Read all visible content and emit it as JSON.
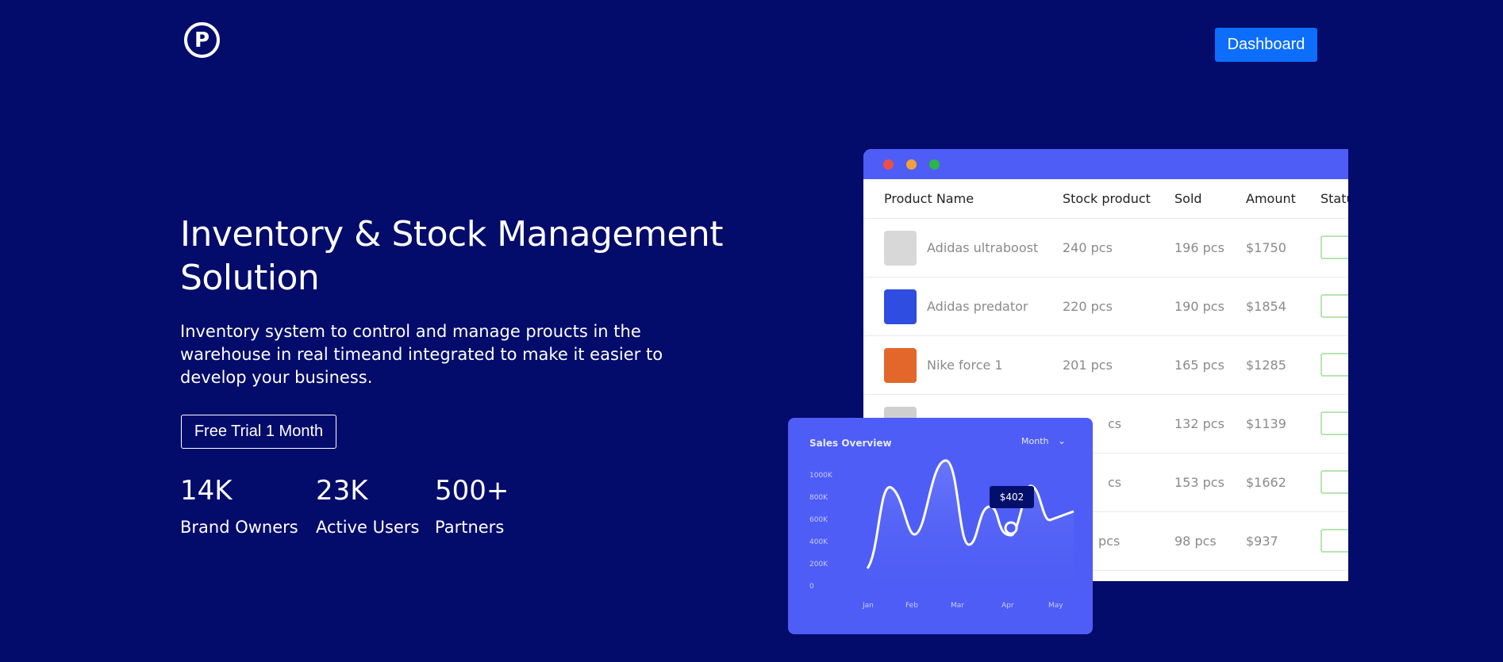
{
  "header": {
    "logo_letter": "P",
    "dashboard_label": "Dashboard"
  },
  "hero": {
    "title": "Inventory & Stock Management Solution",
    "subtitle": "Inventory system to control and manage proucts in the warehouse in real timeand integrated to make it easier to develop your business.",
    "cta_label": "Free Trial 1 Month",
    "stats": [
      {
        "value": "14K",
        "label": "Brand Owners"
      },
      {
        "value": "23K",
        "label": "Active Users"
      },
      {
        "value": "500+",
        "label": "Partners"
      }
    ]
  },
  "table": {
    "columns": [
      "Product Name",
      "Stock product",
      "Sold",
      "Amount",
      "Statu"
    ],
    "rows": [
      {
        "name": "Adidas ultraboost",
        "stock": "240 pcs",
        "sold": "196 pcs",
        "amount": "$1750"
      },
      {
        "name": "Adidas predator",
        "stock": "220 pcs",
        "sold": "190 pcs",
        "amount": "$1854"
      },
      {
        "name": "Nike force 1",
        "stock": "201 pcs",
        "sold": "165 pcs",
        "amount": "$1285"
      },
      {
        "name": "",
        "stock": "cs",
        "sold": "132 pcs",
        "amount": "$1139"
      },
      {
        "name": "",
        "stock": "cs",
        "sold": "153 pcs",
        "amount": "$1662"
      },
      {
        "name": "",
        "stock": "pcs",
        "sold": "98 pcs",
        "amount": "$937"
      }
    ],
    "window_dots": [
      "#e8504a",
      "#f2a13a",
      "#2bb54a"
    ],
    "thumb_colors": [
      "#d8d8d8",
      "#2f4de0",
      "#e3672a",
      "#cfcfcf"
    ]
  },
  "sales": {
    "title": "Sales Overview",
    "period": "Month",
    "tooltip": "$402",
    "y_ticks": [
      "1000K",
      "800K",
      "600K",
      "400K",
      "200K",
      "0"
    ],
    "x_ticks": [
      "Jan",
      "Feb",
      "Mar",
      "Apr",
      "May"
    ]
  },
  "colors": {
    "background": "#030b6b",
    "accent": "#0d6efd",
    "card": "#4e5df5"
  }
}
